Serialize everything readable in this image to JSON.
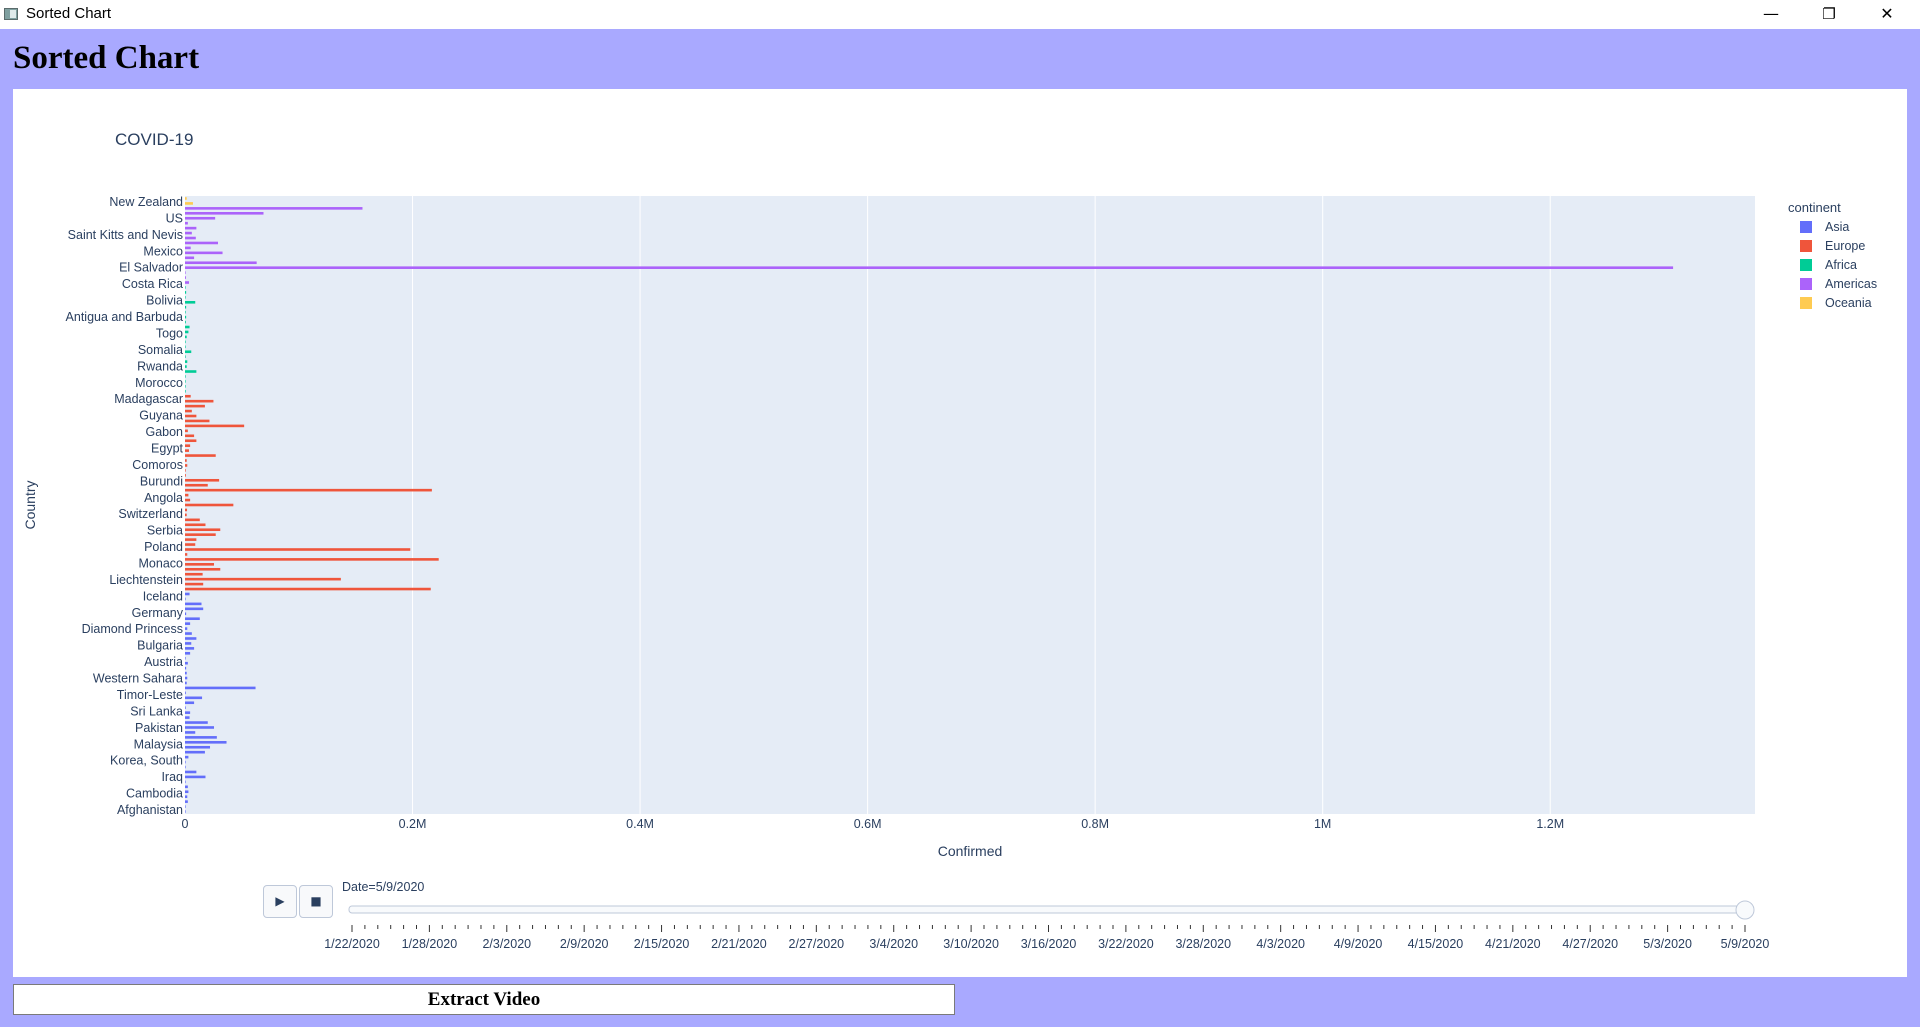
{
  "window": {
    "title": "Sorted Chart",
    "minimize": "—",
    "restore": "❐",
    "close": "✕"
  },
  "app": {
    "title": "Sorted Chart"
  },
  "chart_data": {
    "type": "bar",
    "orientation": "horizontal",
    "title": "COVID-19",
    "xlabel": "Confirmed",
    "ylabel": "Country",
    "xlim": [
      0,
      1380000
    ],
    "grid": true,
    "legend_position": "top-right",
    "x_ticks": [
      {
        "value": 0,
        "label": "0"
      },
      {
        "value": 200000,
        "label": "0.2M"
      },
      {
        "value": 400000,
        "label": "0.4M"
      },
      {
        "value": 600000,
        "label": "0.6M"
      },
      {
        "value": 800000,
        "label": "0.8M"
      },
      {
        "value": 1000000,
        "label": "1M"
      },
      {
        "value": 1200000,
        "label": "1.2M"
      }
    ],
    "y_tick_labels": [
      "New Zealand",
      "US",
      "Saint Kitts and Nevis",
      "Mexico",
      "El Salvador",
      "Costa Rica",
      "Bolivia",
      "Antigua and Barbuda",
      "Togo",
      "Somalia",
      "Rwanda",
      "Morocco",
      "Madagascar",
      "Guyana",
      "Gabon",
      "Egypt",
      "Comoros",
      "Burundi",
      "Angola",
      "Switzerland",
      "Serbia",
      "Poland",
      "Monaco",
      "Liechtenstein",
      "Iceland",
      "Germany",
      "Diamond Princess",
      "Bulgaria",
      "Austria",
      "Western Sahara",
      "Timor-Leste",
      "Sri Lanka",
      "Pakistan",
      "Malaysia",
      "Korea, South",
      "Iraq",
      "Cambodia",
      "Afghanistan"
    ],
    "legend_title": "continent",
    "series": [
      {
        "name": "Asia",
        "color": "#636efa",
        "values": [
          4000,
          300,
          14500,
          16000,
          1000,
          13000,
          4500,
          2000,
          6000,
          10000,
          5500,
          8000,
          4500,
          200,
          2500,
          1000,
          1500,
          2000,
          1500,
          62000,
          700,
          15000,
          8000,
          600,
          4500,
          4000,
          20000,
          25500,
          9000,
          28000,
          36500,
          22000,
          17500,
          3000,
          300,
          300,
          10000,
          18000,
          500,
          2500,
          3000,
          2000,
          2500,
          400,
          500
        ]
      },
      {
        "name": "Europe",
        "color": "#ef553b",
        "values": [
          5000,
          25000,
          17500,
          6000,
          10000,
          21500,
          52000,
          2500,
          8000,
          10000,
          4500,
          3500,
          27000,
          1500,
          2000,
          600,
          700,
          30000,
          20000,
          217000,
          3000,
          4500,
          42500,
          1800,
          1500,
          13000,
          18000,
          31000,
          27000,
          10000,
          9000,
          198000,
          2000,
          223000,
          25500,
          31000,
          15500,
          137000,
          16000,
          216000
        ]
      },
      {
        "name": "Africa",
        "color": "#00cc96",
        "values": [
          400,
          1000,
          200,
          9000,
          1000,
          400,
          1000,
          700,
          4000,
          3000,
          1500,
          100,
          300,
          5500,
          400,
          2000,
          1500,
          10000,
          300,
          100,
          100,
          600
        ]
      },
      {
        "name": "Americas",
        "color": "#ab63fa",
        "values": [
          156000,
          69000,
          26500,
          2500,
          10000,
          6000,
          9500,
          29000,
          5000,
          33000,
          8000,
          63000,
          1308000,
          500,
          800,
          3500
        ]
      },
      {
        "name": "Oceania",
        "color": "#fecb52",
        "values": [
          1500,
          7000
        ]
      }
    ]
  },
  "legend_colors": {
    "Asia": "#636efa",
    "Europe": "#ef553b",
    "Africa": "#00cc96",
    "Americas": "#ab63fa",
    "Oceania": "#fecb52"
  },
  "slider": {
    "current_label": "Date=5/9/2020",
    "tick_labels": [
      "1/22/2020",
      "1/28/2020",
      "2/3/2020",
      "2/9/2020",
      "2/15/2020",
      "2/21/2020",
      "2/27/2020",
      "3/4/2020",
      "3/10/2020",
      "3/16/2020",
      "3/22/2020",
      "3/28/2020",
      "4/3/2020",
      "4/9/2020",
      "4/15/2020",
      "4/21/2020",
      "4/27/2020",
      "5/3/2020",
      "5/9/2020"
    ],
    "position": 1.0,
    "play_icon": "▶",
    "stop_icon": "■"
  },
  "actions": {
    "extract_label": "Extract Video"
  }
}
